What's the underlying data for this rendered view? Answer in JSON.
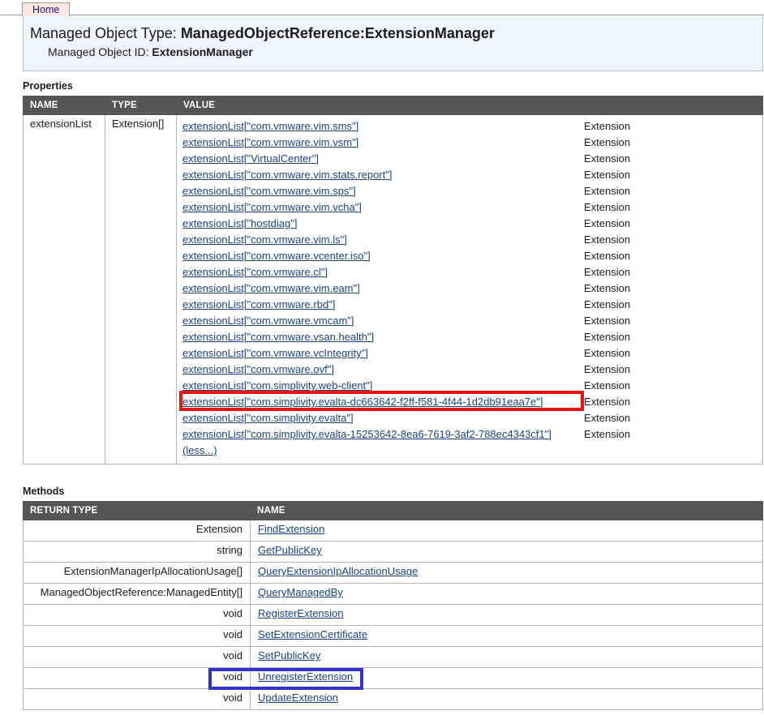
{
  "tab": {
    "label": "Home"
  },
  "header": {
    "type_label": "Managed Object Type:",
    "type_value": "ManagedObjectReference:ExtensionManager",
    "id_label": "Managed Object ID:",
    "id_value": "ExtensionManager"
  },
  "properties": {
    "section_title": "Properties",
    "columns": [
      "NAME",
      "TYPE",
      "VALUE"
    ],
    "row": {
      "name": "extensionList",
      "type": "Extension[]",
      "value_type_label": "Extension",
      "less_label": "(less...)",
      "values": [
        "extensionList[\"com.vmware.vim.sms\"]",
        "extensionList[\"com.vmware.vim.vsm\"]",
        "extensionList[\"VirtualCenter\"]",
        "extensionList[\"com.vmware.vim.stats.report\"]",
        "extensionList[\"com.vmware.vim.sps\"]",
        "extensionList[\"com.vmware.vim.vcha\"]",
        "extensionList[\"hostdiag\"]",
        "extensionList[\"com.vmware.vim.ls\"]",
        "extensionList[\"com.vmware.vcenter.iso\"]",
        "extensionList[\"com.vmware.cl\"]",
        "extensionList[\"com.vmware.vim.eam\"]",
        "extensionList[\"com.vmware.rbd\"]",
        "extensionList[\"com.vmware.vmcam\"]",
        "extensionList[\"com.vmware.vsan.health\"]",
        "extensionList[\"com.vmware.vcIntegrity\"]",
        "extensionList[\"com.vmware.ovf\"]",
        "extensionList[\"com.simplivity.web-client\"]",
        "extensionList[\"com.simplivity.evalta-dc663642-f2ff-f581-4f44-1d2db91eaa7e\"]",
        "extensionList[\"com.simplivity.evalta\"]",
        "extensionList[\"com.simplivity.evalta-15253642-8ea6-7619-3af2-788ec4343cf1\"]"
      ]
    }
  },
  "methods": {
    "section_title": "Methods",
    "columns": [
      "RETURN TYPE",
      "NAME"
    ],
    "rows": [
      {
        "return_type": "Extension",
        "name": "FindExtension"
      },
      {
        "return_type": "string",
        "name": "GetPublicKey"
      },
      {
        "return_type": "ExtensionManagerIpAllocationUsage[]",
        "name": "QueryExtensionIpAllocationUsage"
      },
      {
        "return_type": "ManagedObjectReference:ManagedEntity[]",
        "name": "QueryManagedBy"
      },
      {
        "return_type": "void",
        "name": "RegisterExtension"
      },
      {
        "return_type": "void",
        "name": "SetExtensionCertificate"
      },
      {
        "return_type": "void",
        "name": "SetPublicKey"
      },
      {
        "return_type": "void",
        "name": "UnregisterExtension"
      },
      {
        "return_type": "void",
        "name": "UpdateExtension"
      }
    ]
  },
  "highlights": {
    "red_target": "extensionList[\"com.simplivity.evalta-dc663642-f2ff-f581-4f44-1d2db91eaa7e\"]",
    "red_color": "#ee1111",
    "blue_target": "UnregisterExtension",
    "blue_color": "#3333cc"
  }
}
